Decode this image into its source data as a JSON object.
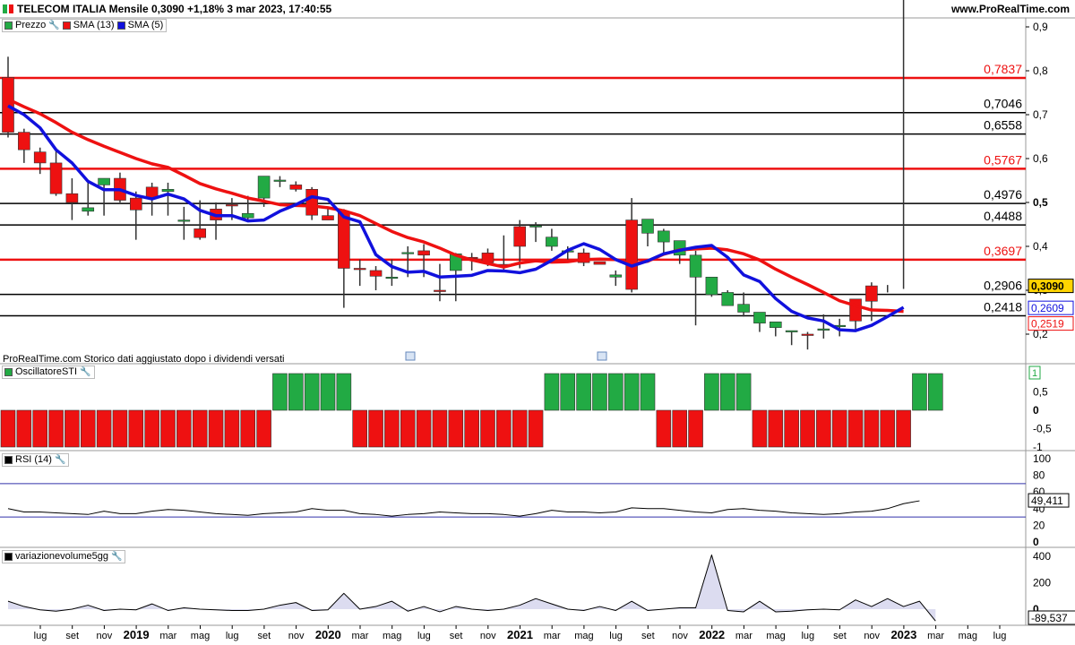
{
  "header": {
    "title": "TELECOM ITALIA Mensile 0,3090 +1,18% 3 mar 2023, 17:40:55",
    "site": "www.ProRealTime.com"
  },
  "credit": "ProRealTime.com  Storico dati aggiustato dopo i dividendi versati",
  "legend": {
    "price": "Prezzo",
    "sma13": "SMA (13)",
    "sma5": "SMA (5)",
    "sti": "OscillatoreSTI",
    "rsi": "RSI (14)",
    "vol": "variazionevolume5gg"
  },
  "colors": {
    "up": "#22aa44",
    "down": "#ee1111",
    "sma13": "#ee1111",
    "sma5": "#1111dd",
    "volfill": "#dcdcf0"
  },
  "chart_data": [
    {
      "type": "candlestick",
      "title": "TELECOM ITALIA Mensile",
      "x": [
        "2018-06",
        "2018-07",
        "2018-08",
        "2018-09",
        "2018-10",
        "2018-11",
        "2018-12",
        "2019-01",
        "2019-02",
        "2019-03",
        "2019-04",
        "2019-05",
        "2019-06",
        "2019-07",
        "2019-08",
        "2019-09",
        "2019-10",
        "2019-11",
        "2019-12",
        "2020-01",
        "2020-02",
        "2020-03",
        "2020-04",
        "2020-05",
        "2020-06",
        "2020-07",
        "2020-08",
        "2020-09",
        "2020-10",
        "2020-11",
        "2020-12",
        "2021-01",
        "2021-02",
        "2021-03",
        "2021-04",
        "2021-05",
        "2021-06",
        "2021-07",
        "2021-08",
        "2021-09",
        "2021-10",
        "2021-11",
        "2021-12",
        "2022-01",
        "2022-02",
        "2022-03",
        "2022-04",
        "2022-05",
        "2022-06",
        "2022-07",
        "2022-08",
        "2022-09",
        "2022-10",
        "2022-11",
        "2022-12",
        "2023-01",
        "2023-02",
        "2023-03"
      ],
      "x_tick_labels": [
        "lug",
        "set",
        "nov",
        "2019",
        "mar",
        "mag",
        "lug",
        "set",
        "nov",
        "2020",
        "mar",
        "mag",
        "lug",
        "set",
        "nov",
        "2021",
        "mar",
        "mag",
        "lug",
        "set",
        "nov",
        "2022",
        "mar",
        "mag",
        "lug",
        "set",
        "nov",
        "2023",
        "mar",
        "mag",
        "lug"
      ],
      "open": [
        0.785,
        0.66,
        0.615,
        0.59,
        0.52,
        0.48,
        0.54,
        0.555,
        0.51,
        0.535,
        0.525,
        0.46,
        0.44,
        0.485,
        0.495,
        0.465,
        0.51,
        0.55,
        0.54,
        0.53,
        0.47,
        0.48,
        0.35,
        0.345,
        0.33,
        0.385,
        0.39,
        0.3,
        0.345,
        0.375,
        0.385,
        0.359,
        0.445,
        0.445,
        0.4,
        0.39,
        0.385,
        0.365,
        0.33,
        0.46,
        0.43,
        0.41,
        0.38,
        0.33,
        0.29,
        0.265,
        0.25,
        0.225,
        0.215,
        0.205,
        0.2,
        0.21,
        0.22,
        0.28,
        0.31
      ],
      "close": [
        0.66,
        0.62,
        0.59,
        0.52,
        0.5,
        0.488,
        0.555,
        0.505,
        0.483,
        0.51,
        0.53,
        0.46,
        0.42,
        0.46,
        0.493,
        0.475,
        0.56,
        0.551,
        0.53,
        0.471,
        0.46,
        0.35,
        0.347,
        0.332,
        0.33,
        0.386,
        0.38,
        0.298,
        0.383,
        0.374,
        0.363,
        0.355,
        0.4,
        0.447,
        0.421,
        0.39,
        0.363,
        0.359,
        0.335,
        0.302,
        0.462,
        0.435,
        0.413,
        0.38,
        0.33,
        0.295,
        0.268,
        0.25,
        0.228,
        0.208,
        0.198,
        0.212,
        0.22,
        0.23,
        0.275,
        0.31,
        0.309
      ],
      "high": [
        0.832,
        0.668,
        0.625,
        0.62,
        0.555,
        0.548,
        0.555,
        0.568,
        0.525,
        0.545,
        0.545,
        0.49,
        0.505,
        0.5,
        0.51,
        0.515,
        0.56,
        0.56,
        0.548,
        0.535,
        0.485,
        0.485,
        0.37,
        0.355,
        0.37,
        0.4,
        0.405,
        0.36,
        0.385,
        0.385,
        0.395,
        0.425,
        0.46,
        0.455,
        0.44,
        0.4,
        0.395,
        0.365,
        0.345,
        0.51,
        0.445,
        0.44,
        0.41,
        0.39,
        0.31,
        0.3,
        0.295,
        0.245,
        0.225,
        0.205,
        0.205,
        0.245,
        0.235,
        0.28,
        0.318,
        0.312
      ],
      "low": [
        0.648,
        0.59,
        0.565,
        0.515,
        0.46,
        0.47,
        0.47,
        0.5,
        0.415,
        0.47,
        0.47,
        0.415,
        0.415,
        0.415,
        0.46,
        0.46,
        0.49,
        0.535,
        0.525,
        0.46,
        0.46,
        0.26,
        0.31,
        0.3,
        0.31,
        0.33,
        0.33,
        0.275,
        0.275,
        0.345,
        0.355,
        0.345,
        0.35,
        0.41,
        0.39,
        0.37,
        0.355,
        0.365,
        0.31,
        0.295,
        0.4,
        0.38,
        0.36,
        0.22,
        0.285,
        0.265,
        0.24,
        0.205,
        0.195,
        0.175,
        0.165,
        0.19,
        0.195,
        0.21,
        0.23,
        0.295,
        0.303
      ],
      "sma13": [
        0.735,
        0.718,
        0.702,
        0.682,
        0.66,
        0.643,
        0.628,
        0.614,
        0.6,
        0.588,
        0.58,
        0.562,
        0.543,
        0.531,
        0.521,
        0.51,
        0.503,
        0.495,
        0.493,
        0.492,
        0.488,
        0.481,
        0.47,
        0.452,
        0.434,
        0.42,
        0.41,
        0.396,
        0.38,
        0.369,
        0.361,
        0.353,
        0.362,
        0.367,
        0.364,
        0.365,
        0.37,
        0.371,
        0.37,
        0.36,
        0.366,
        0.382,
        0.392,
        0.394,
        0.396,
        0.392,
        0.383,
        0.369,
        0.348,
        0.33,
        0.313,
        0.295,
        0.276,
        0.265,
        0.255,
        0.254,
        0.2519
      ],
      "sma5": [
        0.72,
        0.7,
        0.67,
        0.62,
        0.59,
        0.548,
        0.529,
        0.529,
        0.516,
        0.508,
        0.519,
        0.508,
        0.482,
        0.47,
        0.47,
        0.458,
        0.46,
        0.48,
        0.495,
        0.513,
        0.507,
        0.467,
        0.456,
        0.381,
        0.354,
        0.341,
        0.343,
        0.33,
        0.332,
        0.334,
        0.345,
        0.344,
        0.34,
        0.348,
        0.368,
        0.391,
        0.406,
        0.393,
        0.37,
        0.355,
        0.367,
        0.383,
        0.391,
        0.398,
        0.402,
        0.375,
        0.335,
        0.32,
        0.281,
        0.252,
        0.237,
        0.23,
        0.21,
        0.208,
        0.22,
        0.24,
        0.2609
      ],
      "horizontal_levels": [
        {
          "value": 0.7837,
          "label": "0,7837",
          "color": "red"
        },
        {
          "value": 0.7046,
          "label": "0,7046",
          "color": "black"
        },
        {
          "value": 0.6558,
          "label": "0,6558",
          "color": "black"
        },
        {
          "value": 0.5767,
          "label": "0,5767",
          "color": "red"
        },
        {
          "value": 0.4976,
          "label": "0,4976",
          "color": "black"
        },
        {
          "value": 0.4488,
          "label": "0,4488",
          "color": "black"
        },
        {
          "value": 0.3697,
          "label": "0,3697",
          "color": "red"
        },
        {
          "value": 0.2906,
          "label": "0,2906",
          "color": "black"
        },
        {
          "value": 0.2418,
          "label": "0,2418",
          "color": "black"
        }
      ],
      "y_ticks": [
        0.2,
        0.3,
        0.4,
        0.5,
        0.6,
        0.7,
        0.8,
        0.9
      ],
      "y_tick_labels": [
        "0,2",
        "0,3",
        "0,4",
        "0,5",
        "0,6",
        "0,7",
        "0,8",
        "0,9"
      ],
      "ylim": [
        0.15,
        0.9
      ],
      "last_price_label": "0,3090",
      "sma5_label": "0,2609",
      "sma13_label": "0,2519"
    },
    {
      "type": "bar",
      "title": "OscillatoreSTI",
      "values": [
        -1,
        -1,
        -1,
        -1,
        -1,
        -1,
        -1,
        -1,
        -1,
        -1,
        -1,
        -1,
        -1,
        -1,
        -1,
        -1,
        -1,
        1,
        1,
        1,
        1,
        1,
        -1,
        -1,
        -1,
        -1,
        -1,
        -1,
        -1,
        -1,
        -1,
        -1,
        -1,
        -1,
        1,
        1,
        1,
        1,
        1,
        1,
        1,
        -1,
        -1,
        -1,
        1,
        1,
        1,
        -1,
        -1,
        -1,
        -1,
        -1,
        -1,
        -1,
        -1,
        -1,
        -1,
        1,
        1
      ],
      "y_tick_labels": [
        "1",
        "0,5",
        "0",
        "-0,5",
        "-1"
      ],
      "last_value_label": "1",
      "ylim": [
        -1.2,
        1.2
      ]
    },
    {
      "type": "line",
      "title": "RSI (14)",
      "values": [
        40,
        36,
        36,
        35,
        34,
        33,
        37,
        34,
        34,
        37,
        39,
        38,
        36,
        34,
        33,
        32,
        34,
        35,
        36,
        40,
        38,
        38,
        34,
        33,
        31,
        33,
        34,
        36,
        35,
        34,
        34,
        33,
        31,
        34,
        38,
        36,
        36,
        35,
        36,
        41,
        40,
        40,
        38,
        36,
        35,
        39,
        40,
        38,
        37,
        35,
        34,
        33,
        34,
        36,
        37,
        40,
        46,
        49.4
      ],
      "levels": [
        70,
        30
      ],
      "y_tick_labels": [
        "100",
        "80",
        "60",
        "40",
        "20",
        "0"
      ],
      "last_value_label": "49,411",
      "ylim": [
        0,
        100
      ]
    },
    {
      "type": "area",
      "title": "variazionevolume5gg",
      "values": [
        60,
        20,
        -5,
        -15,
        0,
        30,
        -10,
        0,
        -5,
        40,
        -10,
        10,
        0,
        -5,
        -10,
        -10,
        0,
        30,
        50,
        -10,
        -5,
        120,
        0,
        20,
        60,
        -15,
        20,
        -20,
        20,
        0,
        -10,
        0,
        30,
        80,
        40,
        0,
        -10,
        20,
        -10,
        60,
        -10,
        0,
        10,
        10,
        410,
        -10,
        -20,
        60,
        -20,
        -15,
        -5,
        0,
        -5,
        70,
        20,
        80,
        20,
        60,
        -89.5
      ],
      "y_tick_labels": [
        "400",
        "200",
        "0"
      ],
      "last_value_label": "-89,537",
      "ylim": [
        -110,
        440
      ]
    }
  ]
}
